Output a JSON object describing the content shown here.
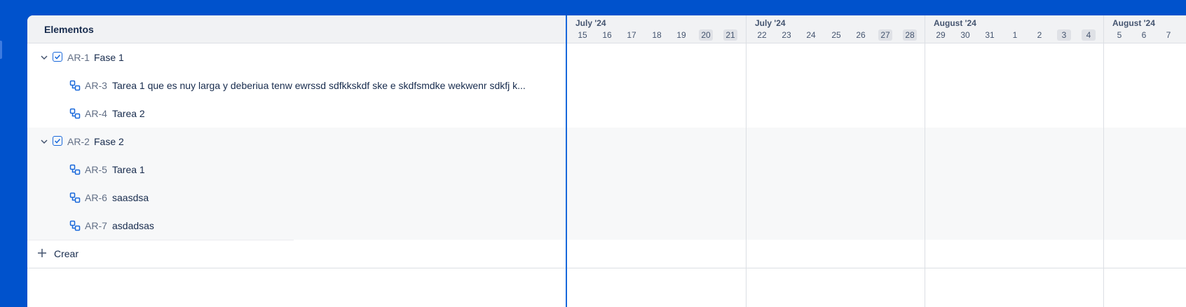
{
  "list": {
    "header": "Elementos",
    "rows": [
      {
        "key": "AR-1",
        "title": "Fase 1",
        "type": "epic"
      },
      {
        "key": "AR-3",
        "title": "Tarea 1 que es nuy larga y deberiua tenw ewrssd sdfkkskdf ske e skdfsmdke wekwenr sdkfj k...",
        "type": "subtask"
      },
      {
        "key": "AR-4",
        "title": "Tarea 2",
        "type": "subtask"
      },
      {
        "key": "AR-2",
        "title": "Fase 2",
        "type": "epic"
      },
      {
        "key": "AR-5",
        "title": "Tarea 1",
        "type": "subtask"
      },
      {
        "key": "AR-6",
        "title": "saasdsa",
        "type": "subtask"
      },
      {
        "key": "AR-7",
        "title": "asdadsas",
        "type": "subtask"
      }
    ],
    "create_label": "Crear"
  },
  "timeline": {
    "weeks": [
      {
        "label": "July '24",
        "days": [
          "15",
          "16",
          "17",
          "18",
          "19",
          "20",
          "21"
        ]
      },
      {
        "label": "July '24",
        "days": [
          "22",
          "23",
          "24",
          "25",
          "26",
          "27",
          "28"
        ]
      },
      {
        "label": "August '24",
        "days": [
          "29",
          "30",
          "31",
          "1",
          "2",
          "3",
          "4"
        ]
      },
      {
        "label": "August '24",
        "days": [
          "5",
          "6",
          "7"
        ]
      }
    ]
  },
  "colors": {
    "frame": "#0052cc",
    "accent": "#1868db",
    "weekend": "#dfe1e6"
  },
  "icons": {
    "expand": "chevron-down-icon",
    "epic": "checkbox-icon",
    "subtask": "subtask-icon",
    "create": "plus-icon"
  }
}
